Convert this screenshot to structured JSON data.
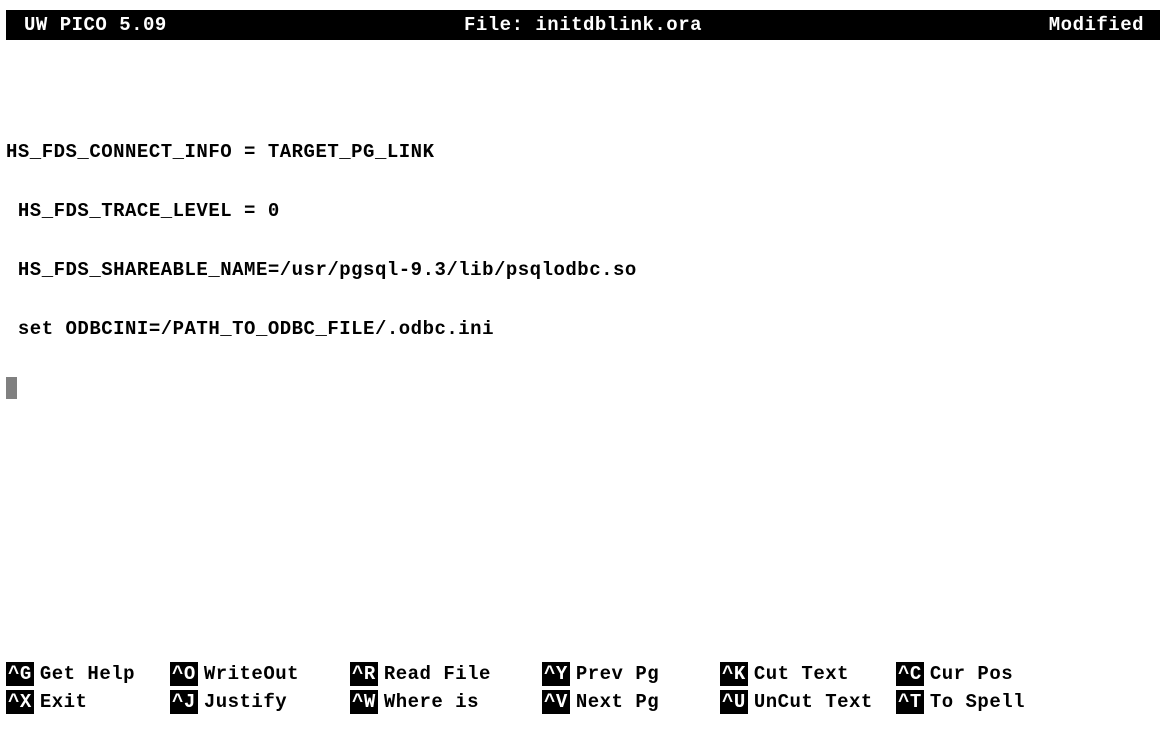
{
  "header": {
    "app": "UW PICO 5.09",
    "file_prefix": "File: ",
    "file_name": "initdblink.ora",
    "status": "Modified"
  },
  "content": {
    "lines": [
      "",
      "",
      "HS_FDS_CONNECT_INFO = TARGET_PG_LINK",
      " HS_FDS_TRACE_LEVEL = 0",
      " HS_FDS_SHAREABLE_NAME=/usr/pgsql-9.3/lib/psqlodbc.so",
      " set ODBCINI=/PATH_TO_ODBC_FILE/.odbc.ini"
    ]
  },
  "shortcuts": {
    "row1": [
      {
        "key": "^G",
        "label": "Get Help"
      },
      {
        "key": "^O",
        "label": "WriteOut"
      },
      {
        "key": "^R",
        "label": "Read File"
      },
      {
        "key": "^Y",
        "label": "Prev Pg"
      },
      {
        "key": "^K",
        "label": "Cut Text"
      },
      {
        "key": "^C",
        "label": "Cur Pos"
      }
    ],
    "row2": [
      {
        "key": "^X",
        "label": "Exit"
      },
      {
        "key": "^J",
        "label": "Justify"
      },
      {
        "key": "^W",
        "label": "Where is"
      },
      {
        "key": "^V",
        "label": "Next Pg"
      },
      {
        "key": "^U",
        "label": "UnCut Text"
      },
      {
        "key": "^T",
        "label": "To Spell"
      }
    ]
  }
}
